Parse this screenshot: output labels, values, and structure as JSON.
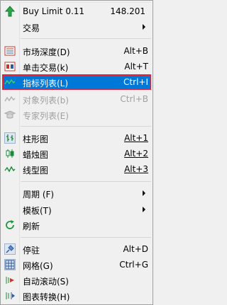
{
  "buy_limit": {
    "label": "Buy Limit 0.11",
    "price": "148.201"
  },
  "trading": {
    "label": "交易"
  },
  "items": {
    "market_depth": {
      "label": "市场深度(D)",
      "shortcut": "Alt+B"
    },
    "one_click": {
      "label": "单击交易(k)",
      "shortcut": "Alt+T"
    },
    "indicators": {
      "label": "指标列表(L)",
      "shortcut": "Ctrl+I"
    },
    "objects": {
      "label": "对象列表(b)",
      "shortcut": "Ctrl+B"
    },
    "experts": {
      "label": "专家列表(E)"
    },
    "bar_chart": {
      "label": "柱形图",
      "shortcut": "Alt+1"
    },
    "candles": {
      "label": "蜡烛图",
      "shortcut": "Alt+2"
    },
    "line_chart": {
      "label": "线型图",
      "shortcut": "Alt+3"
    },
    "period": {
      "label": "周期 (F)"
    },
    "template": {
      "label": "模板(T)"
    },
    "refresh": {
      "label": "刷新"
    },
    "dock": {
      "label": "停驻",
      "shortcut": "Alt+D"
    },
    "grid": {
      "label": "网格(G)",
      "shortcut": "Ctrl+G"
    },
    "autoscroll": {
      "label": "自动滚动(S)"
    },
    "chart_shift": {
      "label": "图表转换(H)"
    }
  },
  "colors": {
    "highlight": "#0078d7",
    "highlight_border": "#e0263c",
    "disabled": "#a0a0a0"
  }
}
